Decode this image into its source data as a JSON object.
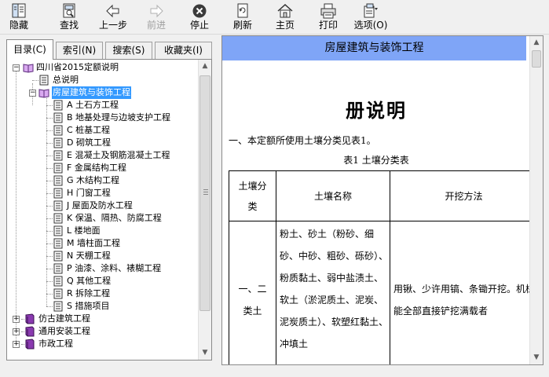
{
  "toolbar": {
    "hide": "隐藏",
    "find": "查找",
    "back": "上一步",
    "forward": "前进",
    "stop": "停止",
    "refresh": "刷新",
    "home": "主页",
    "print": "打印",
    "options": "选项(O)"
  },
  "tabs": {
    "contents": "目录(C)",
    "index": "索引(N)",
    "search": "搜索(S)",
    "favorites": "收藏夹(I)"
  },
  "tree": {
    "root": "四川省2015定额说明",
    "general": "总说明",
    "building": "房屋建筑与装饰工程",
    "chapters": [
      "A 土石方工程",
      "B 地基处理与边坡支护工程",
      "C 桩基工程",
      "D 砌筑工程",
      "E 混凝土及钢筋混凝土工程",
      "F 金属结构工程",
      "G 木结构工程",
      "H 门窗工程",
      "J 屋面及防水工程",
      "K 保温、隔热、防腐工程",
      "L 楼地面",
      "M 墙柱面工程",
      "N 天棚工程",
      "P 油漆、涂料、裱糊工程",
      "Q 其他工程",
      "R 拆除工程",
      "S 措施项目"
    ],
    "books": [
      "仿古建筑工程",
      "通用安装工程",
      "市政工程"
    ]
  },
  "doc": {
    "header": "房屋建筑与装饰工程",
    "title": "册说明",
    "para1": "一、本定额所使用土壤分类见表1。",
    "caption": "表1  土壤分类表",
    "table": {
      "col1_line1": "土壤分",
      "col1_line2": "类",
      "col2": "土壤名称",
      "col3": "开挖方法",
      "row1_class": "一、二类土",
      "row1_names": "粉土、砂土（粉砂、细砂、中砂、粗砂、砾砂）、粉质黏土、弱中盐渍土、软土（淤泥质土、泥炭、泥炭质土）、软塑红黏土、冲填土",
      "row1_method": "用锹、少许用镐、条锄开挖。机械能全部直接铲挖满载者"
    }
  }
}
